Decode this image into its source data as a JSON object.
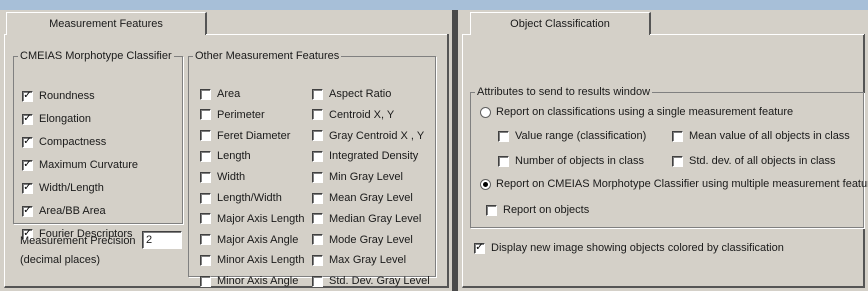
{
  "measurement_tab": {
    "tab_label": "Measurement Features",
    "morphotype_group": {
      "title": "CMEIAS Morphotype Classifier",
      "items": [
        {
          "label": "Roundness",
          "checked": true
        },
        {
          "label": "Elongation",
          "checked": true
        },
        {
          "label": "Compactness",
          "checked": true
        },
        {
          "label": "Maximum Curvature",
          "checked": true
        },
        {
          "label": "Width/Length",
          "checked": true
        },
        {
          "label": "Area/BB Area",
          "checked": true
        },
        {
          "label": "Fourier Descriptors",
          "checked": true
        }
      ]
    },
    "other_group": {
      "title": "Other Measurement Features",
      "col1": [
        {
          "label": "Area",
          "checked": false
        },
        {
          "label": "Perimeter",
          "checked": false
        },
        {
          "label": "Feret Diameter",
          "checked": false
        },
        {
          "label": "Length",
          "checked": false
        },
        {
          "label": "Width",
          "checked": false
        },
        {
          "label": "Length/Width",
          "checked": false
        },
        {
          "label": "Major Axis Length",
          "checked": false
        },
        {
          "label": "Major Axis Angle",
          "checked": false
        },
        {
          "label": "Minor Axis Length",
          "checked": false
        },
        {
          "label": "Minor Axis Angle",
          "checked": false
        }
      ],
      "col2": [
        {
          "label": "Aspect Ratio",
          "checked": false
        },
        {
          "label": "Centroid X, Y",
          "checked": false
        },
        {
          "label": "Gray Centroid X , Y",
          "checked": false
        },
        {
          "label": "Integrated Density",
          "checked": false
        },
        {
          "label": "Min Gray Level",
          "checked": false
        },
        {
          "label": "Mean Gray Level",
          "checked": false
        },
        {
          "label": "Median Gray Level",
          "checked": false
        },
        {
          "label": "Mode Gray Level",
          "checked": false
        },
        {
          "label": "Max Gray Level",
          "checked": false
        },
        {
          "label": "Std. Dev. Gray Level",
          "checked": false
        }
      ]
    },
    "precision": {
      "label": "Measurement Precision",
      "value": "2",
      "sublabel": "(decimal places)"
    }
  },
  "classification_tab": {
    "tab_label": "Object Classification",
    "attributes_group": {
      "title": "Attributes to send to results window",
      "radio_single": {
        "label": "Report on classifications using a single measurement feature",
        "selected": false
      },
      "single_options": [
        {
          "label": "Value range (classification)",
          "checked": false
        },
        {
          "label": "Mean value of all objects in class",
          "checked": false
        },
        {
          "label": "Number of objects in class",
          "checked": false
        },
        {
          "label": "Std. dev. of all objects in class",
          "checked": false
        }
      ],
      "radio_multi": {
        "label": "Report on CMEIAS Morphotype Classifier using multiple measurement features",
        "selected": true
      },
      "report_objects": {
        "label": "Report on objects",
        "checked": false
      }
    },
    "display_new_image": {
      "label": "Display new image showing objects colored by classification",
      "checked": true
    }
  }
}
